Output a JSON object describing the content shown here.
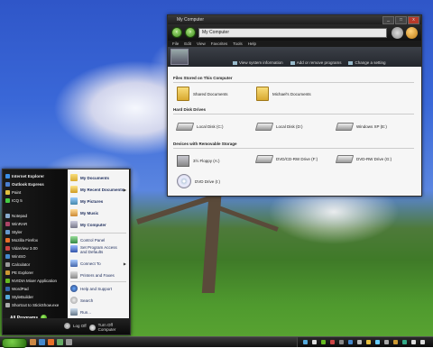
{
  "window": {
    "title": "My Computer",
    "address": "My Computer",
    "menu": [
      "File",
      "Edit",
      "View",
      "Favorites",
      "Tools",
      "Help"
    ],
    "tasks": [
      "View system information",
      "Add or remove programs",
      "Change a setting"
    ],
    "groups": {
      "stored": "Files Stored on This Computer",
      "hdd": "Hard Disk Drives",
      "removable": "Devices with Removable Storage"
    },
    "stored_items": [
      "Shared Documents",
      "Michael's Documents"
    ],
    "hdd_items": [
      "Local Disk (C:)",
      "Local Disk (D:)",
      "Windows XP (E:)"
    ],
    "removable_items": [
      "3½ Floppy (A:)",
      "DVD/CD-RW Drive (F:)",
      "DVD-RW Drive (G:)",
      "DVD Drive (I:)"
    ],
    "buttons": {
      "min": "_",
      "max": "□",
      "close": "x"
    }
  },
  "startmenu": {
    "pinned": [
      "Internet Explorer",
      "Outlook Express"
    ],
    "recent": [
      "Paint",
      "ICQ 5",
      "Notepad",
      "WinRAR",
      "Styler",
      "Mozilla Firefox",
      "VidaView 3.00",
      "WinISO",
      "Calculator",
      "PE Explorer",
      "NVIDIA Mixer Application",
      "WordPad",
      "StyleBuilder",
      "Shortcut to StickShow.exe"
    ],
    "right_bold": [
      "My Documents",
      "My Recent Documents",
      "My Pictures",
      "My Music",
      "My Computer"
    ],
    "right_other": [
      "Control Panel",
      "Set Program Access and Defaults",
      "Connect To",
      "Printers and Faxes",
      "Help and Support",
      "Search",
      "Run..."
    ],
    "all_programs": "All Programs",
    "log_off": "Log Off",
    "turn_off": "Turn Off Computer"
  },
  "colors": {
    "sky": "#3a68d8",
    "grass": "#4f9a2e",
    "window_chrome": "#1e1e1e",
    "startmenu_bg": "#111111",
    "start_green": "#3d8a20"
  }
}
